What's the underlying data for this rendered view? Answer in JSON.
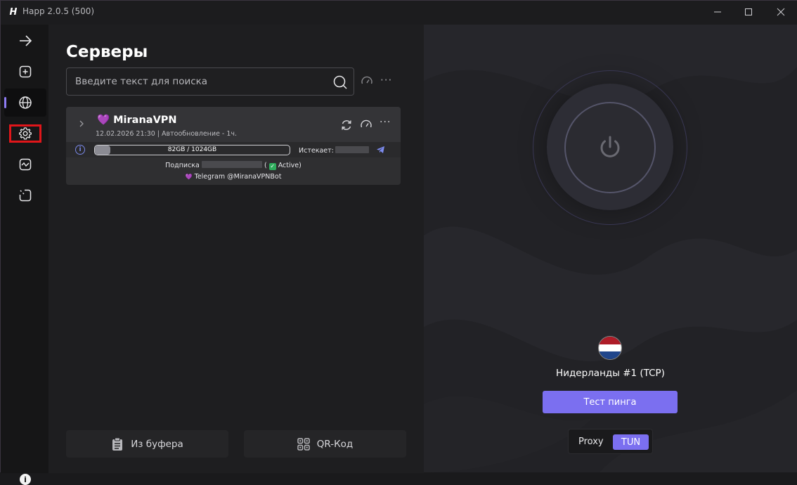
{
  "titlebar": {
    "title": "Happ 2.0.5 (500)",
    "logo": "H"
  },
  "sidebar": {
    "items": [
      {
        "name": "arrow-right-icon"
      },
      {
        "name": "add-icon"
      },
      {
        "name": "globe-icon",
        "active": true
      },
      {
        "name": "gear-icon",
        "highlighted": true
      },
      {
        "name": "activity-icon"
      },
      {
        "name": "routing-icon"
      }
    ],
    "info_label": "i"
  },
  "main": {
    "title": "Серверы",
    "search": {
      "placeholder": "Введите текст для поиска"
    },
    "more_label": "···",
    "subscription": {
      "emoji": "💜",
      "name": "MiranaVPN",
      "meta": "12.02.2026 21:30 | Автообновление - 1ч.",
      "traffic": {
        "used_fraction": 0.08,
        "label": "82GB / 1024GB"
      },
      "expires_label": "Истекает:",
      "subscription_prefix": "Подписка",
      "status_open": "(",
      "status": "Active)",
      "telegram": "Telegram @MiranaVPNBot",
      "more_label": "···"
    },
    "buttons": {
      "clipboard": "Из буфера",
      "qr": "QR-Код"
    }
  },
  "right": {
    "server_name": "Нидерланды #1 (TCP)",
    "ping_button": "Тест пинга",
    "mode": {
      "proxy": "Proxy",
      "tun": "TUN",
      "selected": "TUN"
    },
    "flag_colors": [
      "#ae1c28",
      "#ffffff",
      "#21468b"
    ],
    "accent": "#7b6ff0"
  }
}
